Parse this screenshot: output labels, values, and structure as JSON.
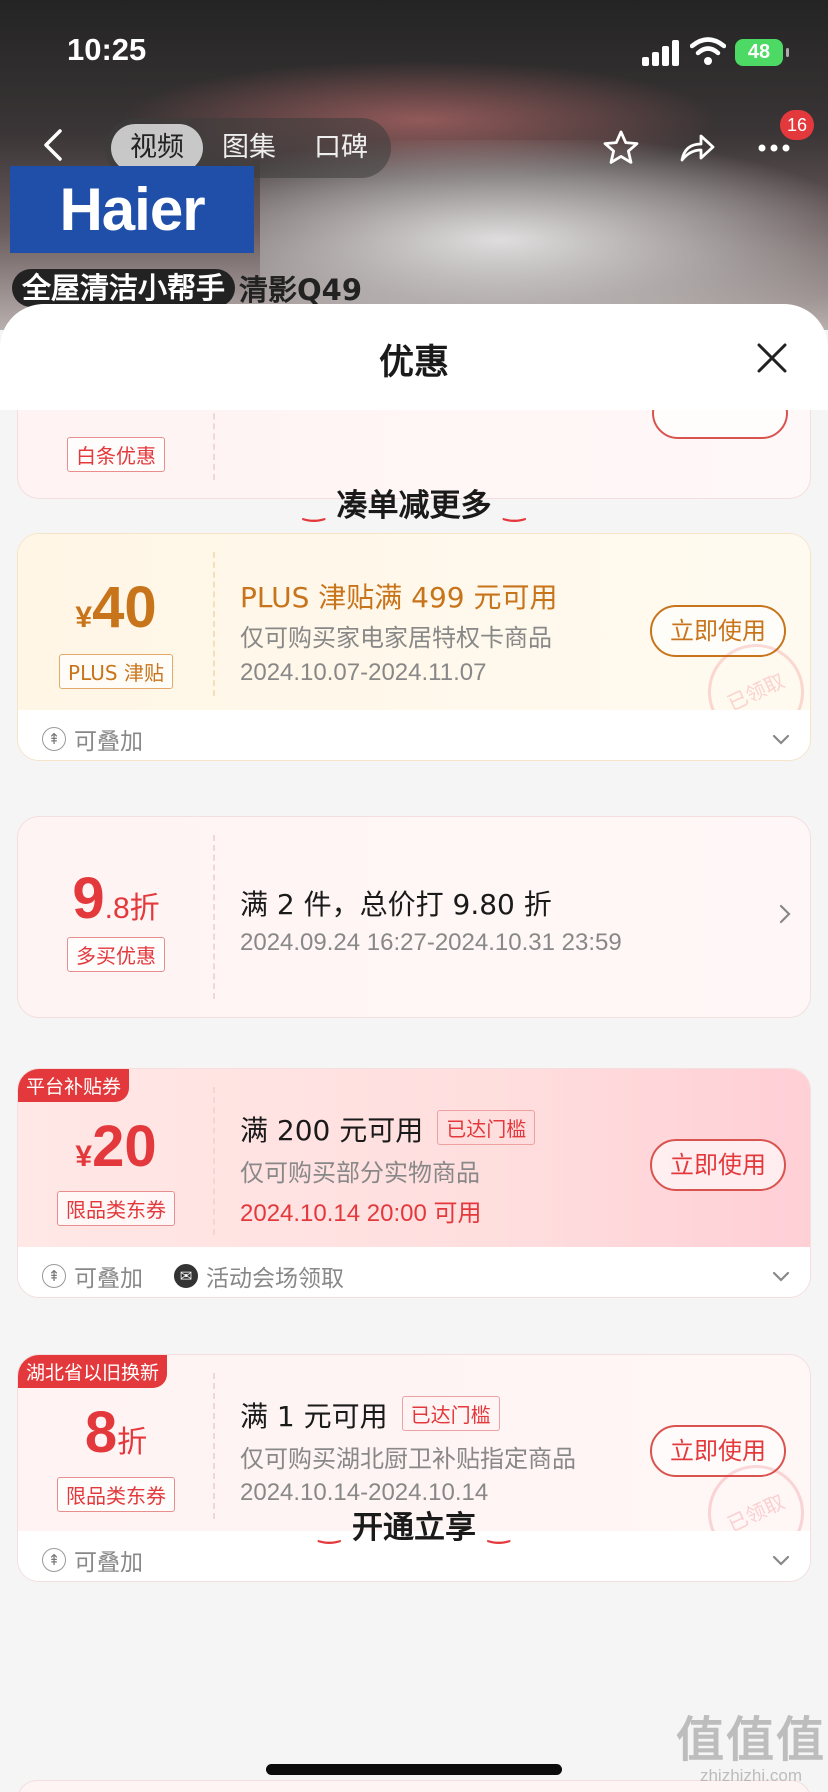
{
  "status_bar": {
    "time": "10:25",
    "battery": "48"
  },
  "nav": {
    "tabs": [
      "视频",
      "图集",
      "口碑"
    ],
    "active_tab": "视频",
    "badge_count": "16"
  },
  "product": {
    "brand": "Haier",
    "slogan": "全屋清洁小帮手",
    "model": "清影Q49"
  },
  "sheet": {
    "title": "优惠"
  },
  "baitiao": {
    "tag": "白条优惠"
  },
  "section_more": {
    "title": "凑单减更多"
  },
  "coupons": [
    {
      "currency": "¥",
      "amount": "40",
      "tag": "PLUS 津贴",
      "title": "PLUS 津贴满 499 元可用",
      "desc": "仅可购买家电家居特权卡商品",
      "date": "2024.10.07-2024.11.07",
      "button": "立即使用",
      "stamp": "已领取",
      "footer": [
        "可叠加"
      ]
    },
    {
      "amount": "9",
      "decimal": ".8",
      "unit": "折",
      "tag": "多买优惠",
      "title": "满 2 件，总价打 9.80 折",
      "date": "2024.09.24 16:27-2024.10.31 23:59"
    },
    {
      "corner": "平台补贴券",
      "currency": "¥",
      "amount": "20",
      "tag": "限品类东券",
      "title": "满 200 元可用",
      "met": "已达门槛",
      "desc": "仅可购买部分实物商品",
      "date": "2024.10.14 20:00 可用",
      "button": "立即使用",
      "footer": [
        "可叠加",
        "活动会场领取"
      ]
    },
    {
      "corner": "湖北省以旧换新",
      "amount": "8",
      "unit": "折",
      "tag": "限品类东券",
      "title": "满 1 元可用",
      "met": "已达门槛",
      "desc": "仅可购买湖北厨卫补贴指定商品",
      "date": "2024.10.14-2024.10.14",
      "button": "立即使用",
      "stamp": "已领取",
      "footer": [
        "可叠加"
      ]
    }
  ],
  "section_open": {
    "title": "开通立享"
  },
  "watermark": {
    "big": "值值值",
    "small": "zhizhizhi.com"
  },
  "colors": {
    "accent": "#e4393c",
    "plus": "#c8741b"
  }
}
